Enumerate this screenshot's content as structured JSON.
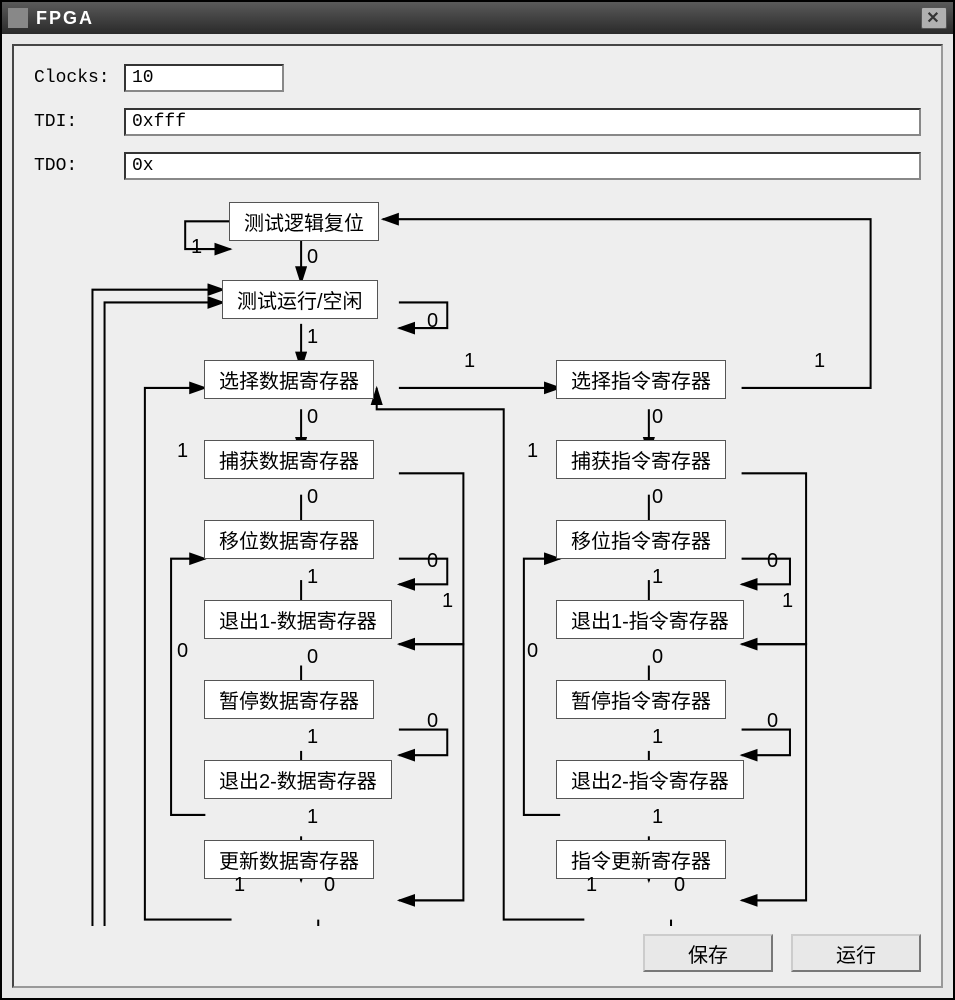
{
  "window": {
    "title": "FPGA"
  },
  "form": {
    "clocks_label": "Clocks:",
    "clocks_value": "10",
    "tdi_label": "TDI:",
    "tdi_value": "0xfff",
    "tdo_label": "TDO:",
    "tdo_value": "0x"
  },
  "states": {
    "reset": "测试逻辑复位",
    "idle": "测试运行/空闲",
    "sel_dr": "选择数据寄存器",
    "cap_dr": "捕获数据寄存器",
    "shift_dr": "移位数据寄存器",
    "exit1_dr": "退出1-数据寄存器",
    "pause_dr": "暂停数据寄存器",
    "exit2_dr": "退出2-数据寄存器",
    "update_dr": "更新数据寄存器",
    "sel_ir": "选择指令寄存器",
    "cap_ir": "捕获指令寄存器",
    "shift_ir": "移位指令寄存器",
    "exit1_ir": "退出1-指令寄存器",
    "pause_ir": "暂停指令寄存器",
    "exit2_ir": "退出2-指令寄存器",
    "update_ir": "指令更新寄存器"
  },
  "edges": {
    "e0": "0",
    "e1": "1"
  },
  "buttons": {
    "save": "保存",
    "run": "运行"
  }
}
